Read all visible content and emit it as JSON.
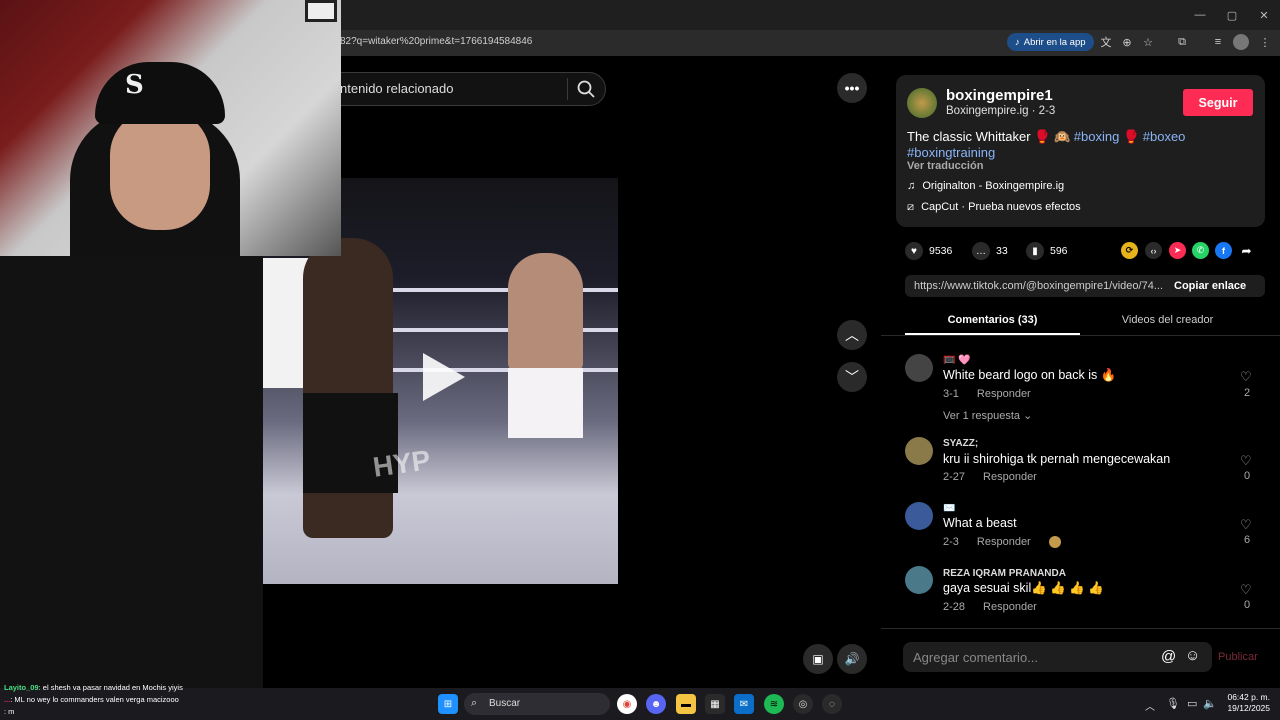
{
  "browser": {
    "url": "82?q=witaker%20prime&t=1766194584846",
    "open_app": "Abrir en la app"
  },
  "search": {
    "text": "ntenido relacionado"
  },
  "video": {
    "overlay_text": "HYP"
  },
  "author": {
    "username": "boxingempire1",
    "subline": "Boxingempire.ig · 2-3",
    "follow": "Seguir"
  },
  "description": {
    "line1_text": "The classic Whittaker 🥊 🙉",
    "tag1": "#boxing",
    "tag1_suffix": "🥊",
    "tag2": "#boxeo",
    "tag3": "#boxingtraining",
    "translate": "Ver traducción",
    "music": "Originalton - Boxingempire.ig",
    "effect": "CapCut · Prueba nuevos efectos"
  },
  "stats": {
    "likes": "9536",
    "comments": "33",
    "saves": "596"
  },
  "link": {
    "url": "https://www.tiktok.com/@boxingempire1/video/74...",
    "copy": "Copiar enlace"
  },
  "tabs": {
    "comments": "Comentarios (33)",
    "creator_videos": "Videos del creador"
  },
  "comments": [
    {
      "name": "🥅 🩷",
      "text": "White beard logo on back is 🔥",
      "date": "3-1",
      "reply": "Responder",
      "likes": "2",
      "more": "Ver 1 respuesta"
    },
    {
      "name": "SYAZZ;",
      "text": "kru ii shirohiga tk pernah mengecewakan",
      "date": "2-27",
      "reply": "Responder",
      "likes": "0"
    },
    {
      "name": "✉️",
      "text": "What a beast",
      "date": "2-3",
      "reply": "Responder",
      "likes": "6"
    },
    {
      "name": "REZA IQRAM PRANANDA",
      "text": "gaya sesuai skil👍 👍 👍 👍",
      "date": "2-28",
      "reply": "Responder",
      "likes": "0"
    }
  ],
  "comment_input": {
    "placeholder": "Agregar comentario...",
    "publish": "Publicar"
  },
  "chat": [
    {
      "user": "Layito_09",
      "msg": ": el shesh va pasar navidad en Mochis yiyis"
    },
    {
      "user": "...",
      "msg": ": ML no wey lo commanders valen verga macizooo"
    },
    {
      "user": "",
      "msg": ": m"
    }
  ],
  "taskbar": {
    "search": "Buscar",
    "time": "06:42 p. m.",
    "date": "19/12/2025"
  }
}
